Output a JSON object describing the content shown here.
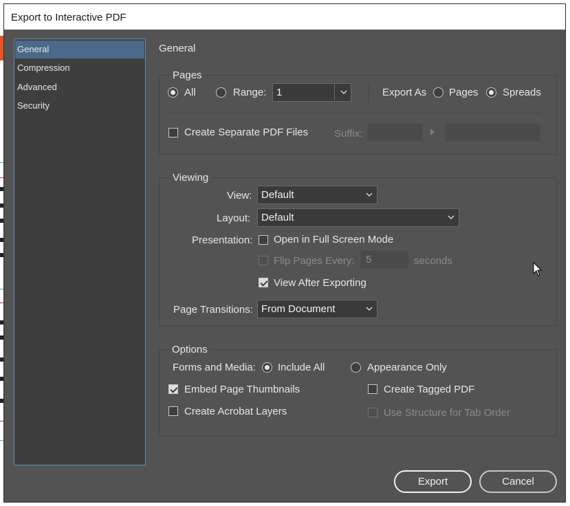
{
  "dialog": {
    "title": "Export to Interactive PDF"
  },
  "sidebar": {
    "items": [
      {
        "label": "General",
        "selected": true
      },
      {
        "label": "Compression",
        "selected": false
      },
      {
        "label": "Advanced",
        "selected": false
      },
      {
        "label": "Security",
        "selected": false
      }
    ]
  },
  "section_title": "General",
  "pages": {
    "label": "Pages",
    "all_label": "All",
    "range_label": "Range:",
    "range_value": "1",
    "export_as_label": "Export As",
    "pages_option": "Pages",
    "spreads_option": "Spreads",
    "separate_label": "Create Separate PDF Files",
    "suffix_label": "Suffix:"
  },
  "viewing": {
    "label": "Viewing",
    "view_label": "View:",
    "view_value": "Default",
    "layout_label": "Layout:",
    "layout_value": "Default",
    "presentation_label": "Presentation:",
    "full_screen_label": "Open in Full Screen Mode",
    "flip_label": "Flip Pages Every:",
    "flip_value": "5",
    "seconds_label": "seconds",
    "view_after_label": "View After Exporting",
    "transitions_label": "Page Transitions:",
    "transitions_value": "From Document"
  },
  "options": {
    "label": "Options",
    "forms_label": "Forms and Media:",
    "include_all_label": "Include All",
    "appearance_only_label": "Appearance Only",
    "thumbnails_label": "Embed Page Thumbnails",
    "tagged_label": "Create Tagged PDF",
    "acrobat_layers_label": "Create Acrobat Layers",
    "structure_label": "Use Structure for Tab Order"
  },
  "buttons": {
    "export": "Export",
    "cancel": "Cancel"
  },
  "colors": {
    "dialog_bg": "#535353",
    "sidebar_bg": "#3e3e3e",
    "selection": "#4b6a8a",
    "sidebar_border": "#6a8fb5"
  }
}
